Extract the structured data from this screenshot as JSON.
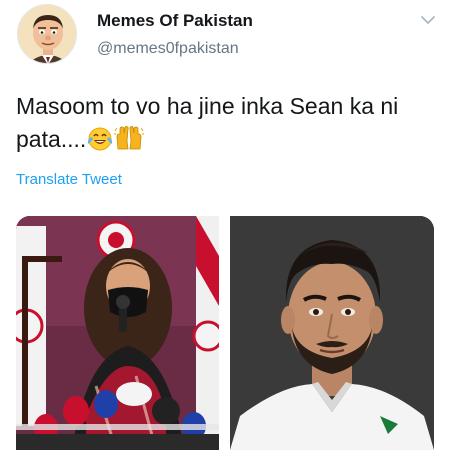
{
  "header": {
    "display_name": "Memes Of Pakistan",
    "handle": "@memes0fpakistan"
  },
  "tweet": {
    "text": "Masoom to vo ha jine  inka Sean ka ni pata....",
    "emojis": [
      "face-with-tears-of-joy",
      "raising-hands"
    ]
  },
  "actions": {
    "translate_label": "Translate Tweet"
  },
  "media": [
    {
      "description": "press-conference-photo"
    },
    {
      "description": "portrait-photo"
    }
  ]
}
